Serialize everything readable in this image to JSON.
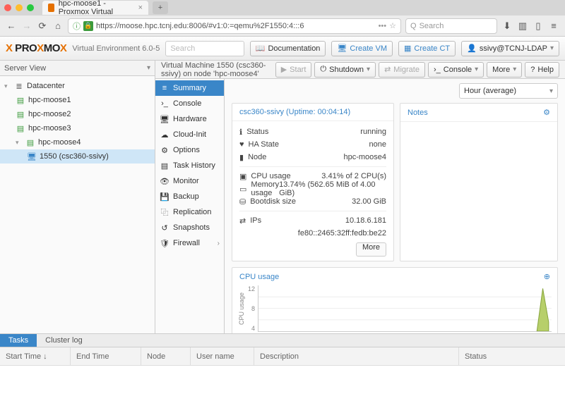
{
  "browser": {
    "tab_title": "hpc-moose1 - Proxmox Virtual",
    "url": "https://moose.hpc.tcnj.edu:8006/#v1:0:=qemu%2F1550:4:::6",
    "search_placeholder": "Search"
  },
  "appbar": {
    "ve_label": "Virtual Environment 6.0-5",
    "search_placeholder": "Search",
    "doc": "Documentation",
    "create_vm": "Create VM",
    "create_ct": "Create CT",
    "user": "ssivy@TCNJ-LDAP"
  },
  "tree": {
    "header": "Server View",
    "root": "Datacenter",
    "nodes": [
      "hpc-moose1",
      "hpc-moose2",
      "hpc-moose3",
      "hpc-moose4"
    ],
    "vm": "1550 (csc360-ssivy)"
  },
  "vm": {
    "title": "Virtual Machine 1550 (csc360-ssivy) on node 'hpc-moose4'",
    "buttons": {
      "start": "Start",
      "shutdown": "Shutdown",
      "migrate": "Migrate",
      "console": "Console",
      "more": "More",
      "help": "Help"
    }
  },
  "sidenav": [
    "Summary",
    "Console",
    "Hardware",
    "Cloud-Init",
    "Options",
    "Task History",
    "Monitor",
    "Backup",
    "Replication",
    "Snapshots",
    "Firewall"
  ],
  "timerange": "Hour (average)",
  "summary": {
    "header": "csc360-ssivy (Uptime: 00:04:14)",
    "status_k": "Status",
    "status_v": "running",
    "ha_k": "HA State",
    "ha_v": "none",
    "node_k": "Node",
    "node_v": "hpc-moose4",
    "cpu_k": "CPU usage",
    "cpu_v": "3.41% of 2 CPU(s)",
    "mem_k": "Memory usage",
    "mem_v": "13.74% (562.65 MiB of 4.00 GiB)",
    "boot_k": "Bootdisk size",
    "boot_v": "32.00 GiB",
    "ips_k": "IPs",
    "ip1": "10.18.6.181",
    "ip2": "fe80::2465:32ff:fedb:be22",
    "more": "More"
  },
  "notes_header": "Notes",
  "chart_header": "CPU usage",
  "bottom": {
    "tab_tasks": "Tasks",
    "tab_cluster": "Cluster log",
    "cols": [
      "Start Time ↓",
      "End Time",
      "Node",
      "User name",
      "Description",
      "Status"
    ]
  },
  "chart_data": {
    "type": "line",
    "ylabel": "CPU usage",
    "ylim": [
      0,
      15
    ],
    "yticks": [
      4,
      8,
      12
    ],
    "series": [
      {
        "name": "CPU usage",
        "values": [
          0,
          0,
          0,
          0,
          0,
          0,
          0,
          0,
          0,
          0,
          0,
          0,
          0,
          0,
          0,
          0,
          0,
          0,
          0,
          0,
          0,
          0,
          0,
          0,
          0,
          0,
          0,
          0,
          0,
          0,
          0,
          0,
          0,
          0,
          0,
          0,
          0,
          0,
          14,
          3
        ]
      }
    ]
  }
}
